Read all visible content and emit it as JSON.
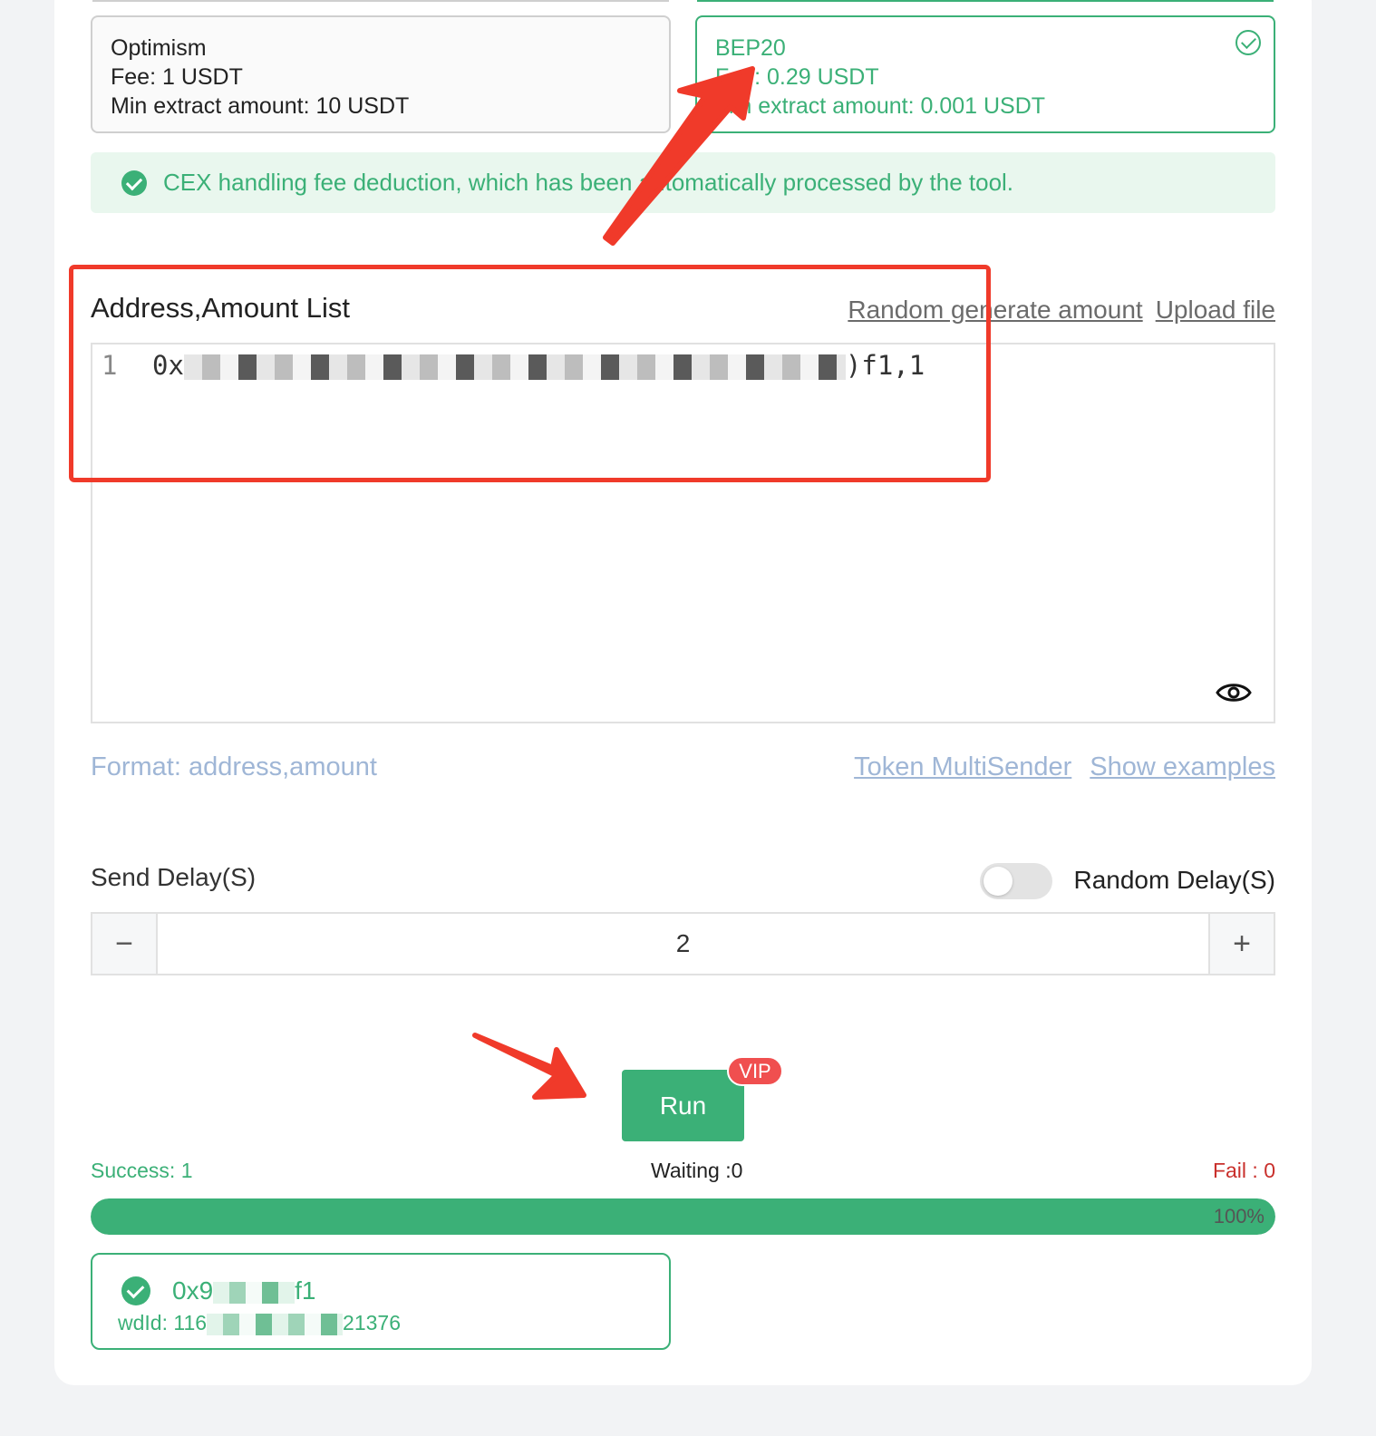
{
  "networks": [
    {
      "name": "Optimism",
      "fee": "Fee: 1 USDT",
      "min": "Min extract amount: 10 USDT",
      "selected": false
    },
    {
      "name": "BEP20",
      "fee": "Fee: 0.29 USDT",
      "min": "Min extract amount: 0.001 USDT",
      "selected": true
    }
  ],
  "notice": {
    "text": "CEX handling fee deduction, which has been automatically processed by the tool."
  },
  "address_list": {
    "title": "Address,Amount List",
    "random_link": "Random generate amount",
    "upload_link": "Upload file",
    "line_number": "1",
    "line_prefix": "0x",
    "line_suffix": ")f1,1",
    "format_hint": "Format: address,amount",
    "token_multisender_link": "Token MultiSender",
    "show_examples_link": "Show examples"
  },
  "delay": {
    "label": "Send Delay(S)",
    "random_label": "Random Delay(S)",
    "random_enabled": false,
    "value": "2",
    "minus": "−",
    "plus": "+"
  },
  "run": {
    "label": "Run",
    "badge": "VIP"
  },
  "stats": {
    "success": "Success: 1",
    "waiting": "Waiting :0",
    "fail": "Fail : 0"
  },
  "progress": {
    "percent": 100,
    "label": "100%"
  },
  "result": {
    "addr_prefix": "0x9",
    "addr_suffix": "f1",
    "wdid_prefix": "wdId: 116",
    "wdid_suffix": "21376"
  },
  "colors": {
    "accent": "#3bb077",
    "danger": "#f03a2a",
    "fail": "#c9302c",
    "link": "#9fb6d6"
  }
}
